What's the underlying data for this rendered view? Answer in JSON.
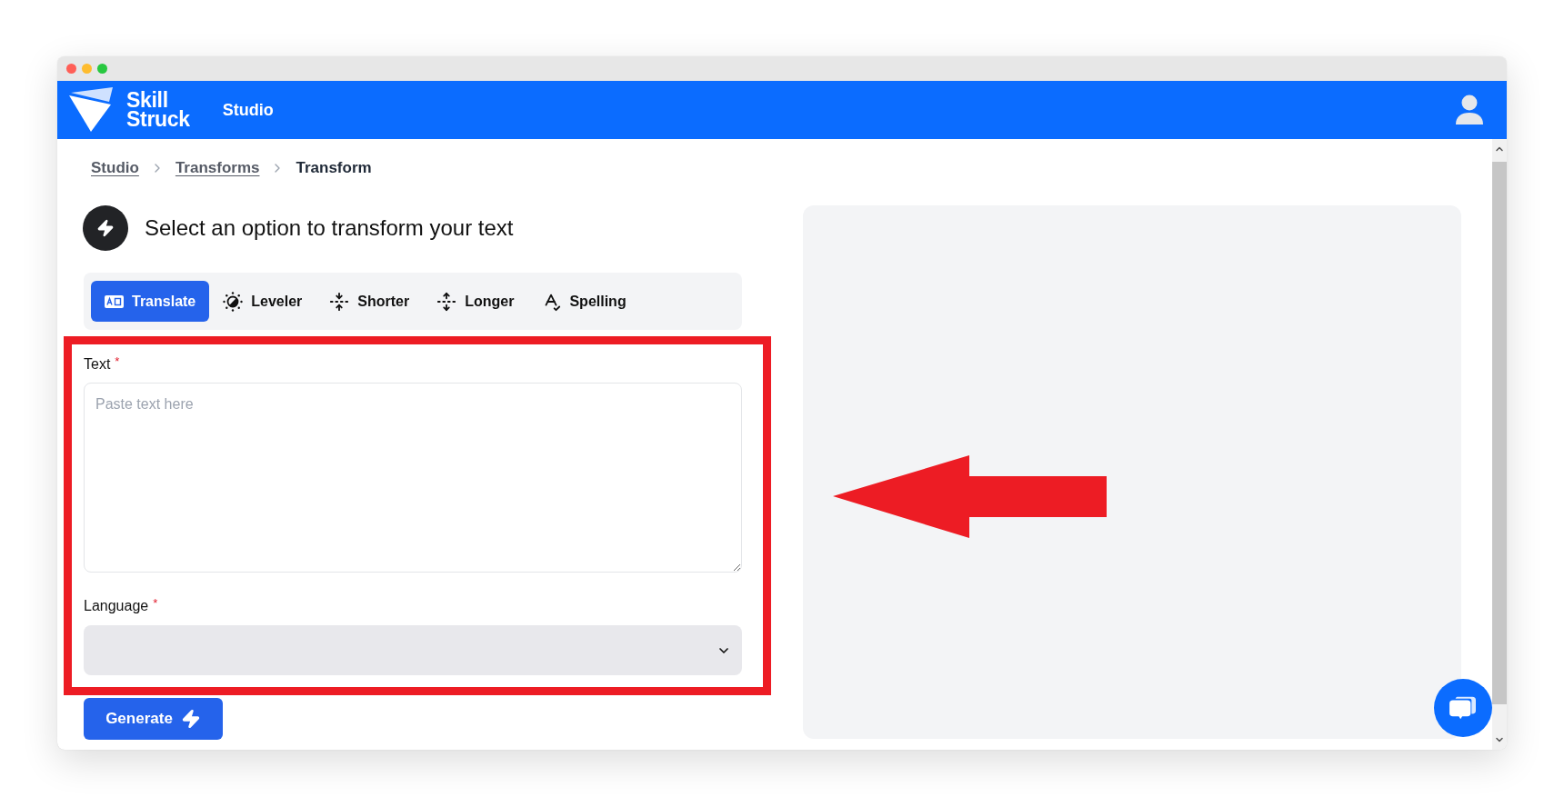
{
  "header": {
    "brand_lines": [
      "Skill",
      "Struck"
    ],
    "nav_link": "Studio"
  },
  "breadcrumb": [
    {
      "label": "Studio",
      "current": false
    },
    {
      "label": "Transforms",
      "current": false
    },
    {
      "label": "Transform",
      "current": true
    }
  ],
  "heading": "Select an option to transform your text",
  "tabs": [
    {
      "label": "Translate",
      "selected": true
    },
    {
      "label": "Leveler",
      "selected": false
    },
    {
      "label": "Shorter",
      "selected": false
    },
    {
      "label": "Longer",
      "selected": false
    },
    {
      "label": "Spelling",
      "selected": false
    }
  ],
  "form": {
    "fields": [
      {
        "kind": "textarea",
        "label": "Text",
        "required_mark": "*",
        "placeholder": "Paste text here"
      },
      {
        "kind": "select",
        "label": "Language",
        "required_mark": "*"
      }
    ],
    "submit": "Generate"
  },
  "annotation": {
    "highlight_frame": true,
    "arrow": true
  }
}
